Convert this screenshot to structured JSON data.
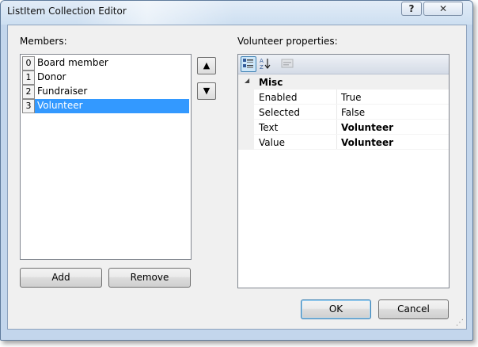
{
  "window": {
    "title": "ListItem Collection Editor",
    "help_glyph": "?",
    "close_glyph": "✕"
  },
  "members": {
    "label": "Members:",
    "items": [
      {
        "index": "0",
        "label": "Board member",
        "selected": false
      },
      {
        "index": "1",
        "label": "Donor",
        "selected": false
      },
      {
        "index": "2",
        "label": "Fundraiser",
        "selected": false
      },
      {
        "index": "3",
        "label": "Volunteer",
        "selected": true
      }
    ],
    "move_up_glyph": "▲",
    "move_down_glyph": "▼",
    "add_label": "Add",
    "remove_label": "Remove"
  },
  "properties": {
    "label": "Volunteer properties:",
    "category": {
      "expand_glyph": "◢",
      "name": "Misc"
    },
    "rows": [
      {
        "name": "Enabled",
        "value": "True",
        "bold": false
      },
      {
        "name": "Selected",
        "value": "False",
        "bold": false
      },
      {
        "name": "Text",
        "value": "Volunteer",
        "bold": true
      },
      {
        "name": "Value",
        "value": "Volunteer",
        "bold": true
      }
    ],
    "toolbar_icons": [
      "categorized-icon",
      "alphabetical-icon",
      "property-pages-icon"
    ]
  },
  "footer": {
    "ok_label": "OK",
    "cancel_label": "Cancel"
  },
  "colors": {
    "selection": "#3399ff",
    "frame": "#c3d6ec",
    "client_bg": "#f0f0f0"
  }
}
